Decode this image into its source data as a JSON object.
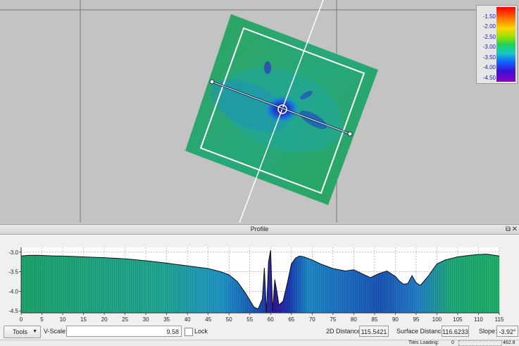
{
  "legend": {
    "ticks": [
      "-1.50",
      "-2.00",
      "-2.50",
      "-3.00",
      "-3.50",
      "-4.00",
      "-4.50"
    ]
  },
  "profile": {
    "title": "Profile",
    "restore_icon": "restore-window-icon",
    "close_icon": "close-icon"
  },
  "chart_data": {
    "type": "area",
    "title": "",
    "xlabel": "",
    "ylabel": "",
    "xlim": [
      0,
      115
    ],
    "ylim": [
      -4.55,
      -2.95
    ],
    "xticks": [
      "0",
      "5",
      "10",
      "15",
      "20",
      "25",
      "30",
      "35",
      "40",
      "45",
      "50",
      "55",
      "60",
      "65",
      "70",
      "75",
      "80",
      "85",
      "90",
      "95",
      "100",
      "105",
      "110",
      "115"
    ],
    "yticks": [
      "-3.0",
      "-3.5",
      "-4.0",
      "-4.5"
    ],
    "grid": true,
    "x": [
      0,
      2,
      4,
      6,
      8,
      10,
      15,
      20,
      25,
      30,
      35,
      40,
      45,
      48,
      50,
      52,
      54,
      56,
      57,
      58,
      58.5,
      59,
      59.5,
      60,
      60.5,
      61,
      61.5,
      62,
      63,
      64,
      65,
      66,
      67,
      68,
      70,
      72,
      75,
      78,
      80,
      82,
      84,
      86,
      88,
      90,
      91,
      92,
      93,
      94,
      95,
      96,
      98,
      100,
      102,
      105,
      108,
      110,
      112,
      115
    ],
    "y": [
      -3.1,
      -3.08,
      -3.08,
      -3.09,
      -3.1,
      -3.1,
      -3.12,
      -3.14,
      -3.17,
      -3.22,
      -3.28,
      -3.35,
      -3.42,
      -3.5,
      -3.58,
      -3.75,
      -4.05,
      -4.4,
      -4.45,
      -4.2,
      -3.4,
      -4.55,
      -3.25,
      -2.95,
      -4.5,
      -3.7,
      -4.0,
      -4.35,
      -4.25,
      -3.8,
      -3.3,
      -3.15,
      -3.1,
      -3.12,
      -3.2,
      -3.3,
      -3.42,
      -3.48,
      -3.45,
      -3.55,
      -3.65,
      -3.55,
      -3.48,
      -3.62,
      -3.74,
      -3.82,
      -3.8,
      -3.6,
      -3.78,
      -3.85,
      -3.6,
      -3.3,
      -3.2,
      -3.12,
      -3.08,
      -3.06,
      -3.05,
      -3.1
    ]
  },
  "toolbar": {
    "tools_label": "Tools",
    "vscale_label": "V-Scale:",
    "vscale_value": "9.58",
    "lock_label": "Lock",
    "dist2d_label": "2D Distance:",
    "dist2d_value": "115.5421",
    "surface_label": "Surface Distance:",
    "surface_value": "116.6233",
    "slope_label": "Slope:",
    "slope_value": "-3.92°"
  },
  "statusbar": {
    "tiles_label": "Tiles Loading:",
    "tiles_value": "0",
    "memory_value": "462.8 M"
  }
}
